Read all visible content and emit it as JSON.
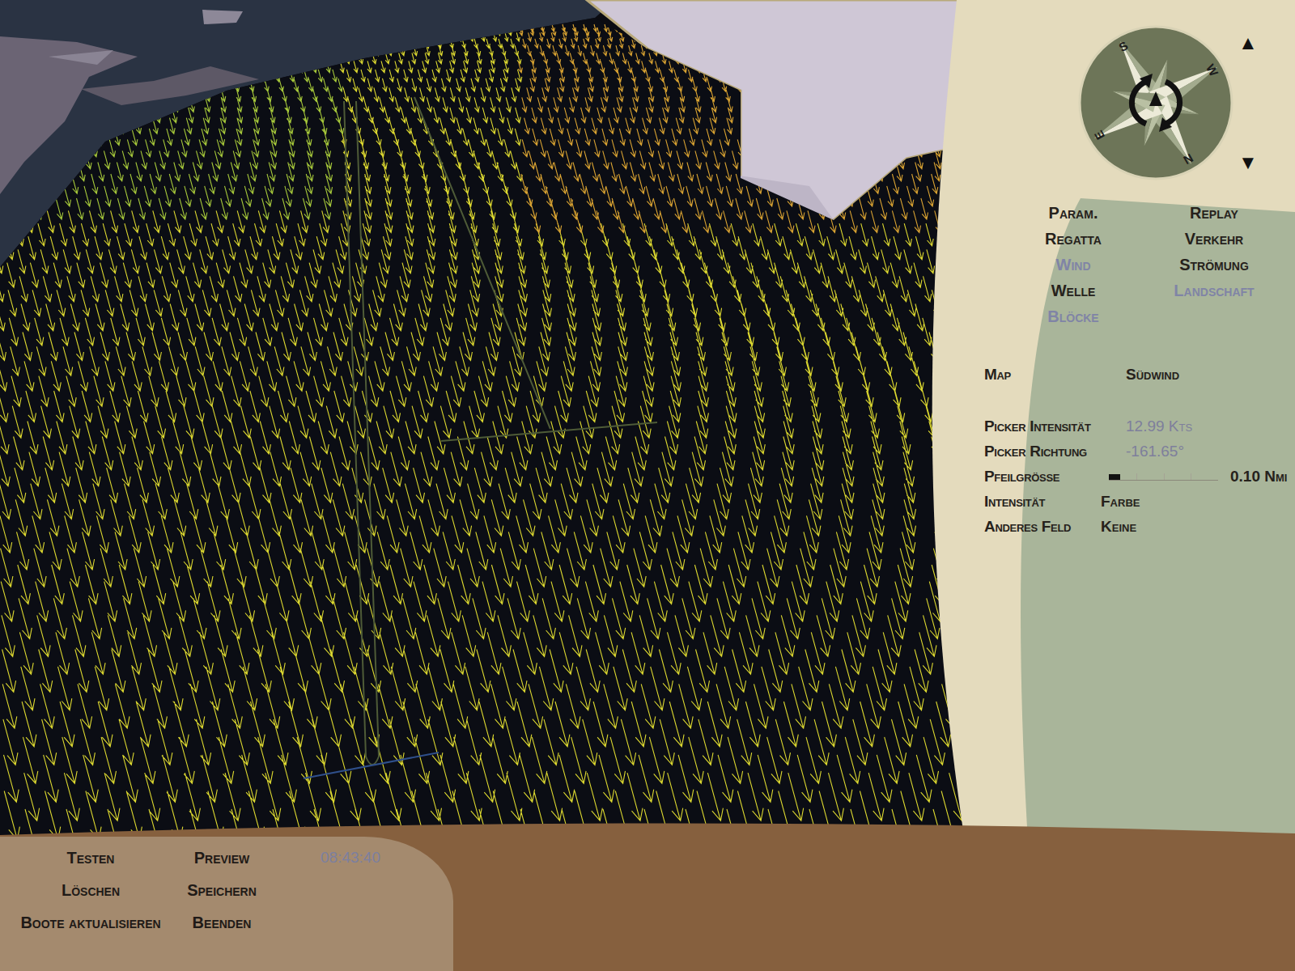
{
  "compass": {
    "labels": [
      "S",
      "W",
      "N",
      "E"
    ],
    "up": "▲",
    "down": "▼"
  },
  "menu": {
    "left": [
      {
        "label": "Param.",
        "disabled": false
      },
      {
        "label": "Regatta",
        "disabled": false
      },
      {
        "label": "Wind",
        "disabled": true
      },
      {
        "label": "Welle",
        "disabled": false
      },
      {
        "label": "Blöcke",
        "disabled": true
      }
    ],
    "right": [
      {
        "label": "Replay",
        "disabled": false
      },
      {
        "label": "Verkehr",
        "disabled": false
      },
      {
        "label": "Strömung",
        "disabled": false
      },
      {
        "label": "Landschaft",
        "disabled": true
      }
    ]
  },
  "sections": [
    {
      "fields": [
        {
          "label": "Map",
          "value": "Südwind",
          "kind": "option"
        }
      ]
    },
    {
      "fields": [
        {
          "label": "Picker Intensität",
          "value": "12.99 Kts",
          "kind": "reading"
        },
        {
          "label": "Picker Richtung",
          "value": "-161.65°",
          "kind": "reading"
        }
      ]
    },
    {
      "fields": [
        {
          "label": "Pfeilgrösse",
          "kind": "slider",
          "level": 0.1,
          "reading": "0.10 Nmi"
        },
        {
          "label": "Intensität",
          "value": "Farbe",
          "kind": "option"
        },
        {
          "label": "Anderes Feld",
          "value": "Keine",
          "kind": "option"
        }
      ]
    }
  ],
  "toolbar": {
    "button_rows": [
      [
        "Testen",
        "Preview"
      ],
      [
        "Löschen",
        "Speichern"
      ],
      [
        "Boote aktualisieren",
        "Beenden"
      ]
    ],
    "time": "08:43:40"
  }
}
